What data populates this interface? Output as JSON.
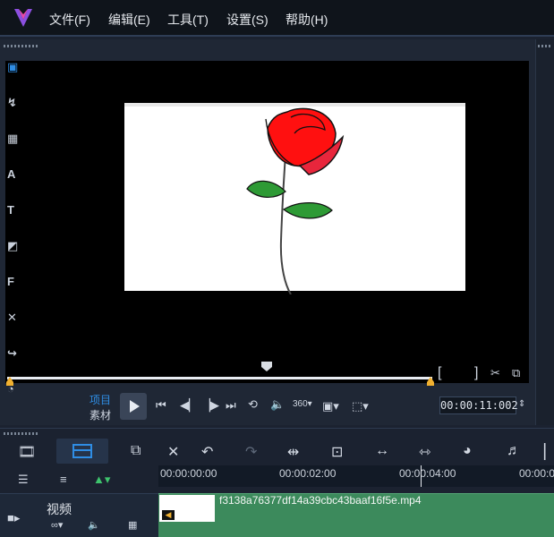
{
  "menu": {
    "file": "文件(F)",
    "edit": "编辑(E)",
    "tools": "工具(T)",
    "settings": "设置(S)",
    "help": "帮助(H)"
  },
  "player": {
    "mode_project": "项目",
    "mode_clip": "素材",
    "timecode": "00:00:11:002",
    "bracket_in": "[",
    "bracket_out": "]"
  },
  "timeline": {
    "ticks": [
      "00:00:00:00",
      "00:00:02:00",
      "00:00:04:00",
      "00:00:0"
    ],
    "track_label": "视频",
    "clip_name": "f3138a76377df14a39cbc43baaf16f5e.mp4"
  },
  "colors": {
    "accent_blue": "#2f8de4",
    "clip_green": "#3c8a5c",
    "scrub_marker": "#f0b030"
  }
}
